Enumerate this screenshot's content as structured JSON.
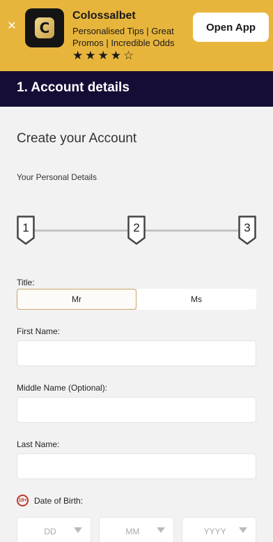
{
  "banner": {
    "close_icon": "close-icon",
    "app_name": "Colossalbet",
    "tagline": "Personalised Tips | Great Promos | Incredible Odds",
    "rating": 4,
    "rating_max": 5,
    "open_label": "Open App"
  },
  "section": {
    "title": "1. Account details"
  },
  "form": {
    "heading": "Create your Account",
    "subheading": "Your Personal Details",
    "steps": [
      "1",
      "2",
      "3"
    ],
    "title_label": "Title:",
    "title_options": [
      "Mr",
      "Ms"
    ],
    "title_selected": "Mr",
    "first_name_label": "First Name:",
    "middle_name_label": "Middle Name (Optional):",
    "last_name_label": "Last Name:",
    "dob_badge": "18+",
    "dob_label": "Date of Birth:",
    "dob_day": "DD",
    "dob_month": "MM",
    "dob_year": "YYYY"
  }
}
